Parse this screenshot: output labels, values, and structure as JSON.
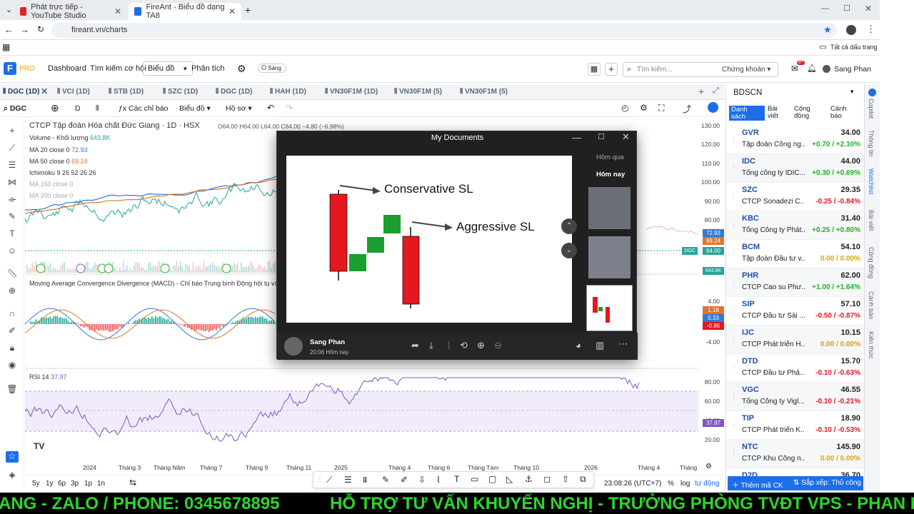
{
  "browser": {
    "tabs": [
      {
        "label": "Phát trực tiếp - YouTube Studio",
        "active": false
      },
      {
        "label": "FireAnt - Biểu đồ dạng TA8",
        "active": true
      }
    ],
    "url": "fireant.vn/charts",
    "bookmarks_label": "Tất cả dấu trang"
  },
  "app": {
    "logo_text": "PRO",
    "nav": [
      "Dashboard",
      "Tìm kiếm cơ hội",
      "Biểu đồ",
      "Phân tích"
    ],
    "theme_toggle": "Sáng",
    "search_placeholder": "Tìm kiếm...",
    "search_scope": "Chứng khoán",
    "user": "Sang Phan",
    "badge_count": "9+"
  },
  "chart_tabs": [
    "DGC (1D)",
    "VCI (1D)",
    "STB (1D)",
    "SZC (1D)",
    "DGC (1D)",
    "HAH (1D)",
    "VN30F1M (1D)",
    "VN30F1M (5)",
    "VN30F1M (5)"
  ],
  "toolbar": {
    "symbol": "DGC",
    "interval": "D",
    "indicators": "Các chỉ báo",
    "chart_type": "Biểu đồ",
    "profile": "Hồ sơ"
  },
  "legend": {
    "title": "CTCP Tập đoàn Hóa chất Đức Giang · 1D · HSX",
    "ohlc": "O64.00 H64.00 L64.00 C64.00 −4.80 (−6.98%)",
    "volume_label": "Volume - Khối lượng",
    "volume_val": "643.8K",
    "ma20_label": "MA 20 close 0",
    "ma20_val": "72.93",
    "ma50_label": "MA 50 close 0",
    "ma50_val": "69.24",
    "ichimoku": "Ichimoku 9 26 52 26 26",
    "ma150": "MA 150 close 0",
    "ma200": "MA 200 close 0",
    "macd": "Moving Average Convergence Divergence (MACD) - Chỉ báo Trung bình Động hội tụ và phân kỳ",
    "rsi_label": "RSI 14",
    "rsi_val": "37.97"
  },
  "yaxis": {
    "price": [
      "130.00",
      "120.00",
      "110.00",
      "100.00",
      "90.00",
      "80.00"
    ],
    "macd": [
      "4.00",
      "2.00",
      "-2.00",
      "-4.00"
    ],
    "rsi": [
      "80.00",
      "60.00",
      "40.00",
      "20.00"
    ],
    "badges": {
      "ma20": "72.93",
      "ma50": "69.24",
      "last": "64.00",
      "last_sym": "DGC",
      "vol": "643.8K",
      "m1": "1.18",
      "m2": "0.33",
      "m3": "-0.86",
      "rsi": "37.97"
    }
  },
  "xaxis": [
    "2024",
    "Tháng 3",
    "Tháng Năm",
    "Tháng 7",
    "Tháng 9",
    "Tháng 11",
    "2025",
    "Tháng 4",
    "Tháng 6",
    "Tháng Tám",
    "Tháng 10",
    "2026",
    "Tháng 4",
    "Tháng"
  ],
  "timeframes": [
    "5y",
    "1y",
    "6p",
    "3p",
    "1p",
    "1n"
  ],
  "bottom_right": {
    "clock": "23:08:26 (UTC+7)",
    "pct": "%",
    "log": "log",
    "auto": "tự động"
  },
  "watchlist": {
    "name": "BDSCN",
    "tabs": [
      "Danh sách",
      "Bài viết",
      "Cộng đồng",
      "Cảnh báo"
    ],
    "items": [
      {
        "sym": "GVR",
        "name": "Tập đoàn Công ng...",
        "price": "34.00",
        "chg": "+0.70 / +2.10%",
        "dir": "up"
      },
      {
        "sym": "IDC",
        "name": "Tổng công ty IDIC...",
        "price": "44.00",
        "chg": "+0.30 / +0.69%",
        "dir": "up"
      },
      {
        "sym": "SZC",
        "name": "CTCP Sonadezi C...",
        "price": "29.35",
        "chg": "-0.25 / -0.84%",
        "dir": "down"
      },
      {
        "sym": "KBC",
        "name": "Tổng Công ty Phát...",
        "price": "31.40",
        "chg": "+0.25 / +0.80%",
        "dir": "up"
      },
      {
        "sym": "BCM",
        "name": "Tập đoàn Đầu tư v...",
        "price": "54.10",
        "chg": "0.00 / 0.00%",
        "dir": "flat"
      },
      {
        "sym": "PHR",
        "name": "CTCP Cao su Phư...",
        "price": "62.00",
        "chg": "+1.00 / +1.64%",
        "dir": "up"
      },
      {
        "sym": "SIP",
        "name": "CTCP Đầu tư Sài ...",
        "price": "57.10",
        "chg": "-0.50 / -0.87%",
        "dir": "down"
      },
      {
        "sym": "IJC",
        "name": "CTCP Phát triển H...",
        "price": "10.15",
        "chg": "0.00 / 0.00%",
        "dir": "flat"
      },
      {
        "sym": "DTD",
        "name": "CTCP Đầu tư Phá...",
        "price": "15.70",
        "chg": "-0.10 / -0.63%",
        "dir": "down"
      },
      {
        "sym": "VGC",
        "name": "Tổng Công ty Vigl...",
        "price": "46.55",
        "chg": "-0.10 / -0.21%",
        "dir": "down"
      },
      {
        "sym": "TIP",
        "name": "CTCP Phát triển K...",
        "price": "18.90",
        "chg": "-0.10 / -0.53%",
        "dir": "down"
      },
      {
        "sym": "NTC",
        "name": "CTCP Khu Công n...",
        "price": "145.90",
        "chg": "0.00 / 0.00%",
        "dir": "flat"
      },
      {
        "sym": "D2D",
        "name": "",
        "price": "36.70",
        "chg": "",
        "dir": "flat"
      }
    ],
    "add": "Thêm mã CK",
    "sort": "Sắp xếp: Thủ công"
  },
  "side_tabs": [
    "Copilot",
    "Thông tin",
    "Watchlist",
    "Bài viết",
    "Cộng đồng",
    "Cảnh báo",
    "Kiến thức"
  ],
  "viewer": {
    "title": "My Documents",
    "labels": [
      "Hôm qua",
      "Hôm nay"
    ],
    "image_text1": "Conservative SL",
    "image_text2": "Aggressive SL",
    "author": "Sang Phan",
    "time": "20:06 Hôm nay"
  },
  "ticker": {
    "left": "ANG - ZALO / PHONE: 0345678895",
    "right": "HỖ TRỢ TƯ VẤN KHUYẾN NGHỊ - TRƯỞNG PHÒNG TVĐT VPS - PHAN H"
  },
  "colors": {
    "up": "#1fb41f",
    "down": "#e5171f",
    "flat": "#d7a400",
    "accent": "#1d6ee8"
  }
}
